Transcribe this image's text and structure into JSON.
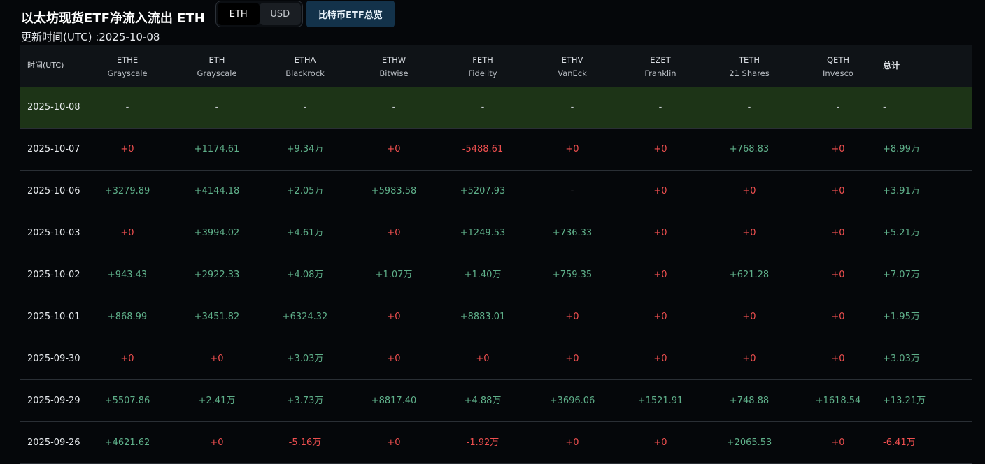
{
  "header": {
    "title": "以太坊现货ETF净流入流出 ETH",
    "toggle": [
      "ETH",
      "USD"
    ],
    "overview_label": "比特币ETF总览",
    "updated": "更新时间(UTC) :2025-10-08"
  },
  "table": {
    "time_header": "时间(UTC)",
    "total_header": "总计",
    "columns": [
      {
        "code": "ETHE",
        "issuer": "Grayscale"
      },
      {
        "code": "ETH",
        "issuer": "Grayscale"
      },
      {
        "code": "ETHA",
        "issuer": "Blackrock"
      },
      {
        "code": "ETHW",
        "issuer": "Bitwise"
      },
      {
        "code": "FETH",
        "issuer": "Fidelity"
      },
      {
        "code": "ETHV",
        "issuer": "VanEck"
      },
      {
        "code": "EZET",
        "issuer": "Franklin"
      },
      {
        "code": "TETH",
        "issuer": "21 Shares"
      },
      {
        "code": "QETH",
        "issuer": "Invesco"
      }
    ],
    "rows": [
      {
        "date": "2025-10-08",
        "cells": [
          "-",
          "-",
          "-",
          "-",
          "-",
          "-",
          "-",
          "-",
          "-"
        ],
        "total": "-"
      },
      {
        "date": "2025-10-07",
        "cells": [
          "+0",
          "+1174.61",
          "+9.34万",
          "+0",
          "-5488.61",
          "+0",
          "+0",
          "+768.83",
          "+0"
        ],
        "total": "+8.99万"
      },
      {
        "date": "2025-10-06",
        "cells": [
          "+3279.89",
          "+4144.18",
          "+2.05万",
          "+5983.58",
          "+5207.93",
          "-",
          "+0",
          "+0",
          "+0"
        ],
        "total": "+3.91万"
      },
      {
        "date": "2025-10-03",
        "cells": [
          "+0",
          "+3994.02",
          "+4.61万",
          "+0",
          "+1249.53",
          "+736.33",
          "+0",
          "+0",
          "+0"
        ],
        "total": "+5.21万"
      },
      {
        "date": "2025-10-02",
        "cells": [
          "+943.43",
          "+2922.33",
          "+4.08万",
          "+1.07万",
          "+1.40万",
          "+759.35",
          "+0",
          "+621.28",
          "+0"
        ],
        "total": "+7.07万"
      },
      {
        "date": "2025-10-01",
        "cells": [
          "+868.99",
          "+3451.82",
          "+6324.32",
          "+0",
          "+8883.01",
          "+0",
          "+0",
          "+0",
          "+0"
        ],
        "total": "+1.95万"
      },
      {
        "date": "2025-09-30",
        "cells": [
          "+0",
          "+0",
          "+3.03万",
          "+0",
          "+0",
          "+0",
          "+0",
          "+0",
          "+0"
        ],
        "total": "+3.03万"
      },
      {
        "date": "2025-09-29",
        "cells": [
          "+5507.86",
          "+2.41万",
          "+3.73万",
          "+8817.40",
          "+4.88万",
          "+3696.06",
          "+1521.91",
          "+748.88",
          "+1618.54"
        ],
        "total": "+13.21万"
      },
      {
        "date": "2025-09-26",
        "cells": [
          "+4621.62",
          "+0",
          "-5.16万",
          "+0",
          "-1.92万",
          "+0",
          "+0",
          "+2065.53",
          "+0"
        ],
        "total": "-6.41万"
      }
    ]
  },
  "colors": {
    "positive": "#5fb08a",
    "negative": "#ef4f4f",
    "highlight_row": "#1d3417",
    "overview_button": "#13324a"
  }
}
